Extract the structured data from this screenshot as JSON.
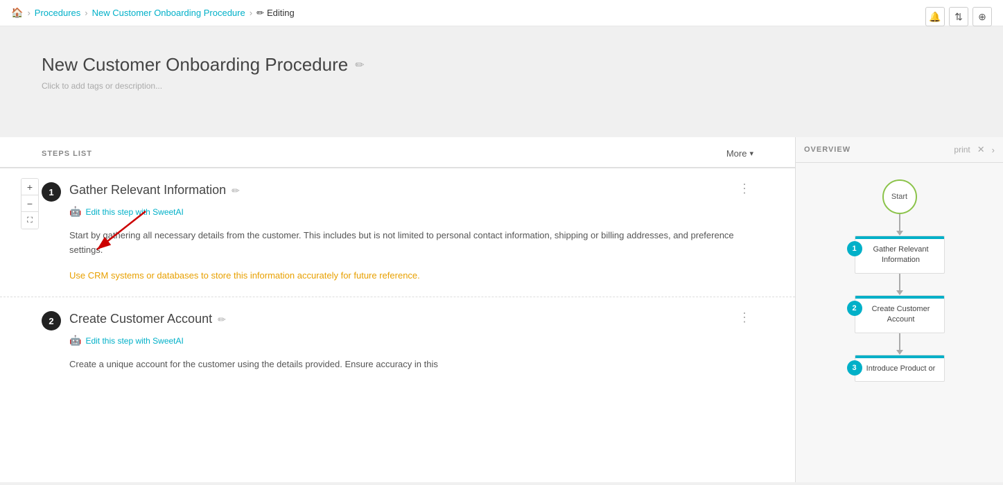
{
  "breadcrumb": {
    "home_icon": "🏠",
    "procedures_label": "Procedures",
    "procedure_name": "New Customer Onboarding Procedure",
    "editing_label": "Editing",
    "edit_pencil": "✏"
  },
  "top_icons": {
    "bell": "🔔",
    "sort": "⇅",
    "globe": "⊕"
  },
  "header": {
    "title": "New Customer Onboarding Procedure",
    "pencil": "✏",
    "subtitle": "Click to add tags or description..."
  },
  "steps": {
    "label": "STEPS LIST",
    "more_label": "More",
    "items": [
      {
        "number": "1",
        "title": "Gather Relevant Information",
        "edit_ai_label": "Edit this step with SweetAI",
        "body_text": "Start by gathering all necessary details from the customer. This includes but is not limited to personal contact information, shipping or billing addresses, and preference settings.",
        "tip_text": "Use CRM systems or databases to store this information accurately for future reference."
      },
      {
        "number": "2",
        "title": "Create Customer Account",
        "edit_ai_label": "Edit this step with SweetAI",
        "body_text": "Create a unique account for the customer using the details provided. Ensure accuracy in this"
      }
    ]
  },
  "overview": {
    "label": "OVERVIEW",
    "print_label": "print",
    "start_label": "Start",
    "nodes": [
      {
        "number": "1",
        "title": "Gather Relevant\nInformation"
      },
      {
        "number": "2",
        "title": "Create Customer\nAccount"
      },
      {
        "number": "3",
        "title": "Introduce Product or"
      }
    ]
  },
  "zoom": {
    "plus": "+",
    "minus": "−",
    "fit": "⛶"
  }
}
